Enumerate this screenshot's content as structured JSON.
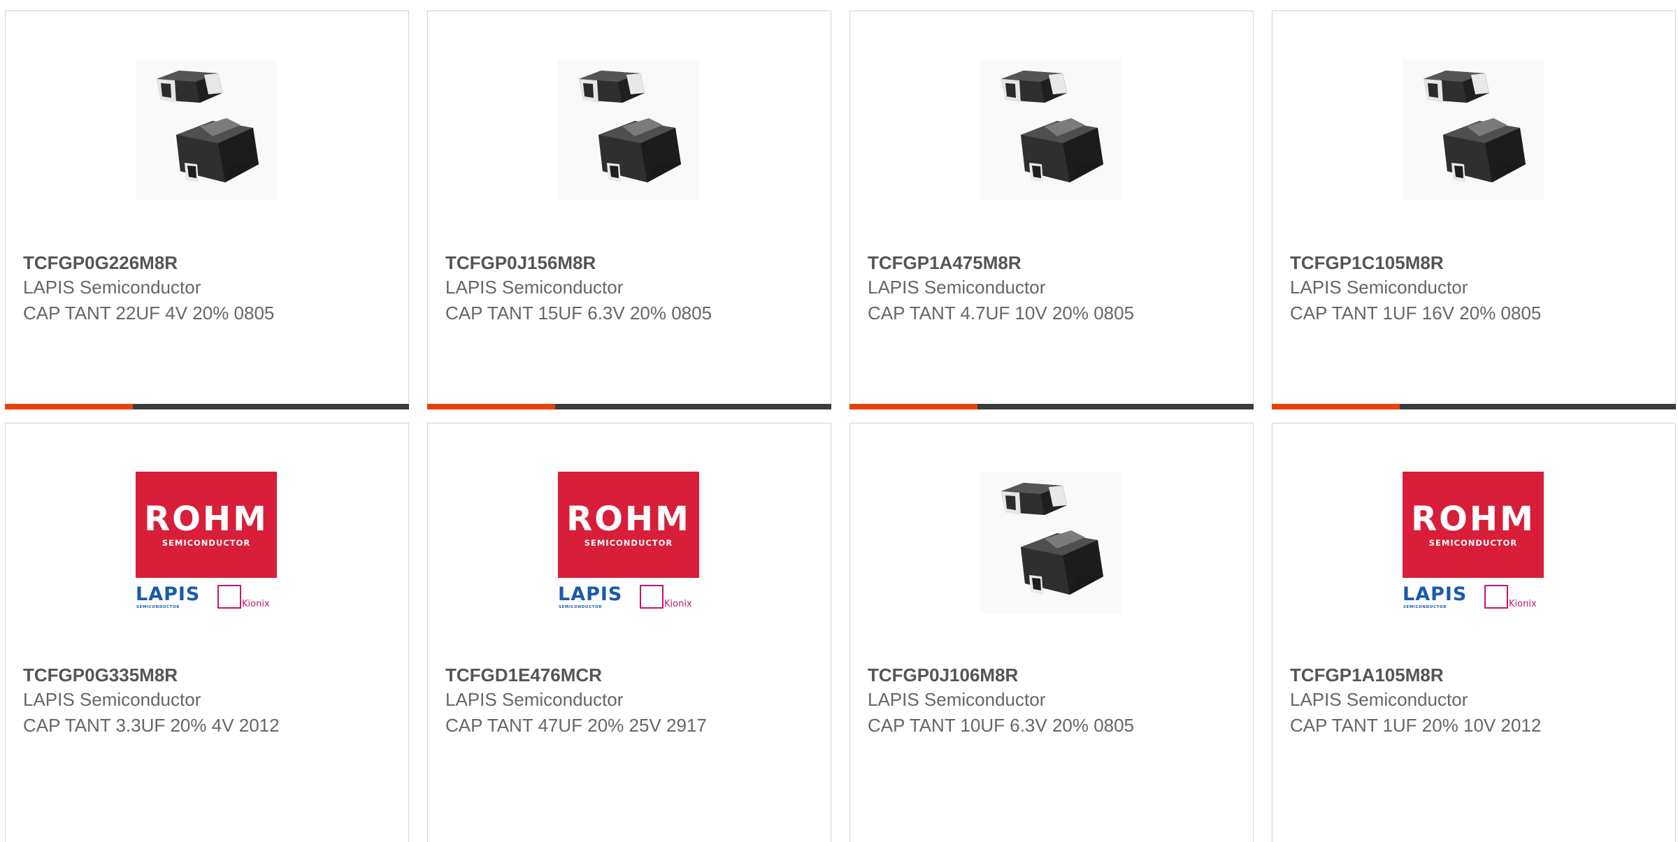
{
  "colors": {
    "accent_bar": "#e8400c",
    "dark_bar": "#3c3c3c",
    "rohm_red": "#d81e38",
    "lapis_blue": "#1a5aa8",
    "kionix_magenta": "#c4146c"
  },
  "logo": {
    "rohm": "ROHM",
    "rohm_sub": "SEMICONDUCTOR",
    "lapis": "LAPIS",
    "lapis_sub": "SEMICONDUCTOR",
    "kionix": "Kionix"
  },
  "products": [
    {
      "part_number": "TCFGP0G226M8R",
      "manufacturer": "LAPIS Semiconductor",
      "description": "CAP TANT 22UF 4V 20% 0805",
      "image": "tantalum-capacitor-image"
    },
    {
      "part_number": "TCFGP0J156M8R",
      "manufacturer": "LAPIS Semiconductor",
      "description": "CAP TANT 15UF 6.3V 20% 0805",
      "image": "tantalum-capacitor-image"
    },
    {
      "part_number": "TCFGP1A475M8R",
      "manufacturer": "LAPIS Semiconductor",
      "description": "CAP TANT 4.7UF 10V 20% 0805",
      "image": "tantalum-capacitor-image"
    },
    {
      "part_number": "TCFGP1C105M8R",
      "manufacturer": "LAPIS Semiconductor",
      "description": "CAP TANT 1UF 16V 20% 0805",
      "image": "tantalum-capacitor-image"
    },
    {
      "part_number": "TCFGP0G335M8R",
      "manufacturer": "LAPIS Semiconductor",
      "description": "CAP TANT 3.3UF 20% 4V 2012",
      "image": "rohm-lapis-logo"
    },
    {
      "part_number": "TCFGD1E476MCR",
      "manufacturer": "LAPIS Semiconductor",
      "description": "CAP TANT 47UF 20% 25V 2917",
      "image": "rohm-lapis-logo"
    },
    {
      "part_number": "TCFGP0J106M8R",
      "manufacturer": "LAPIS Semiconductor",
      "description": "CAP TANT 10UF 6.3V 20% 0805",
      "image": "tantalum-capacitor-image"
    },
    {
      "part_number": "TCFGP1A105M8R",
      "manufacturer": "LAPIS Semiconductor",
      "description": "CAP TANT 1UF 20% 10V 2012",
      "image": "rohm-lapis-logo"
    }
  ]
}
